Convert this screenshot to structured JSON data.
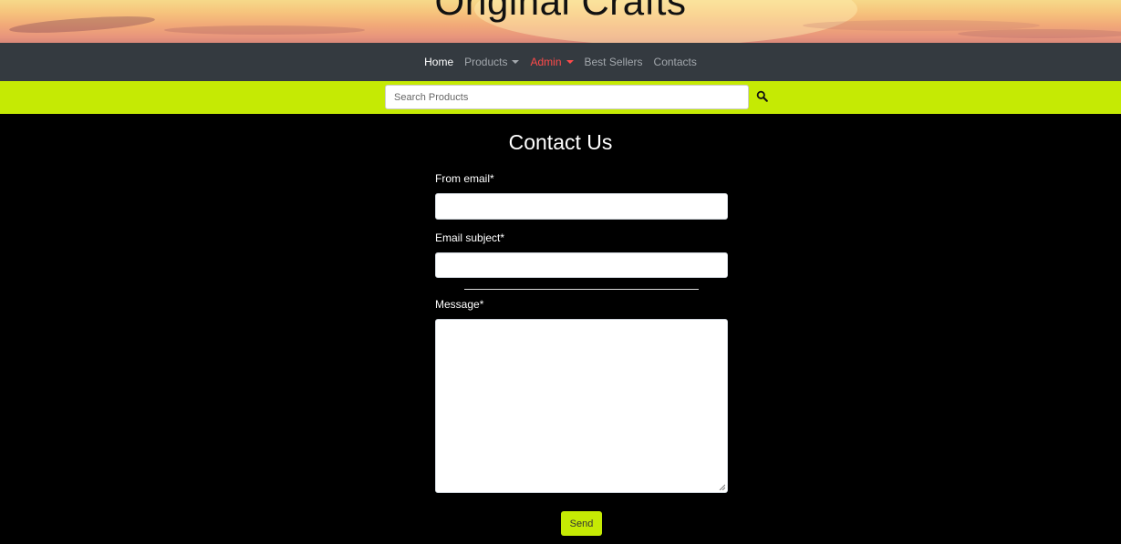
{
  "banner": {
    "title": "Original Crafts"
  },
  "nav": {
    "items": [
      {
        "label": "Home"
      },
      {
        "label": "Products"
      },
      {
        "label": "Admin"
      },
      {
        "label": "Best Sellers"
      },
      {
        "label": "Contacts"
      }
    ]
  },
  "search": {
    "placeholder": "Search Products",
    "value": ""
  },
  "contact": {
    "heading": "Contact Us",
    "from_email_label": "From email*",
    "from_email_value": "",
    "subject_label": "Email subject*",
    "subject_value": "",
    "message_label": "Message*",
    "message_value": "",
    "send_label": "Send"
  },
  "colors": {
    "navbar": "#343a40",
    "accent": "#c5ea04",
    "admin": "#ff4a4a",
    "background": "#000000"
  }
}
